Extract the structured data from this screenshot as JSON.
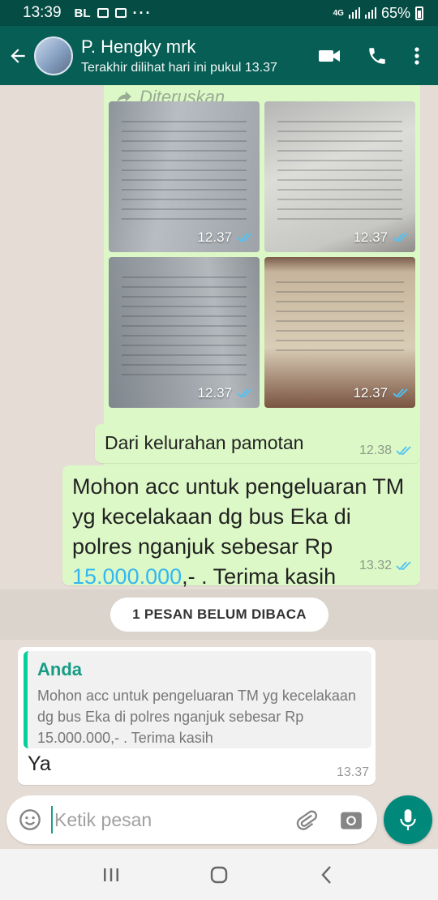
{
  "status_bar": {
    "time": "13:39",
    "carrier_label": "BL",
    "network_label": "4G",
    "battery_text": "65%"
  },
  "header": {
    "contact_name": "P. Hengky mrk",
    "last_seen": "Terakhir dilihat hari ini pukul 13.37",
    "icons": [
      "back-arrow-icon",
      "video-call-icon",
      "phone-icon",
      "more-vert-icon"
    ]
  },
  "messages": {
    "forwarded_label": "Diteruskan",
    "media": [
      {
        "time": "12.37"
      },
      {
        "time": "12.37"
      },
      {
        "time": "12.37"
      },
      {
        "time": "12.37"
      }
    ],
    "msg1": {
      "text": "Dari kelurahan pamotan",
      "time": "12.38"
    },
    "msg2": {
      "text_before": "Mohon acc untuk pengeluaran TM yg kecelakaan dg bus Eka di polres nganjuk sebesar Rp ",
      "amount": "15.000.000",
      "text_after": ",- . Terima kasih",
      "time": "13.32"
    },
    "unread_label": "1 PESAN BELUM DIBACA",
    "reply": {
      "quoted_author": "Anda",
      "quoted_text": "Mohon acc untuk pengeluaran TM yg kecelakaan dg bus Eka di polres nganjuk sebesar Rp 15.000.000,- . Terima kasih",
      "text": "Ya",
      "time": "13.37"
    }
  },
  "composer": {
    "placeholder": "Ketik pesan"
  },
  "colors": {
    "header": "#075e54",
    "status_bar": "#054d44",
    "outgoing_bubble": "#dcf8c6",
    "read_ticks": "#34b7f1",
    "mic_button": "#00897b"
  }
}
